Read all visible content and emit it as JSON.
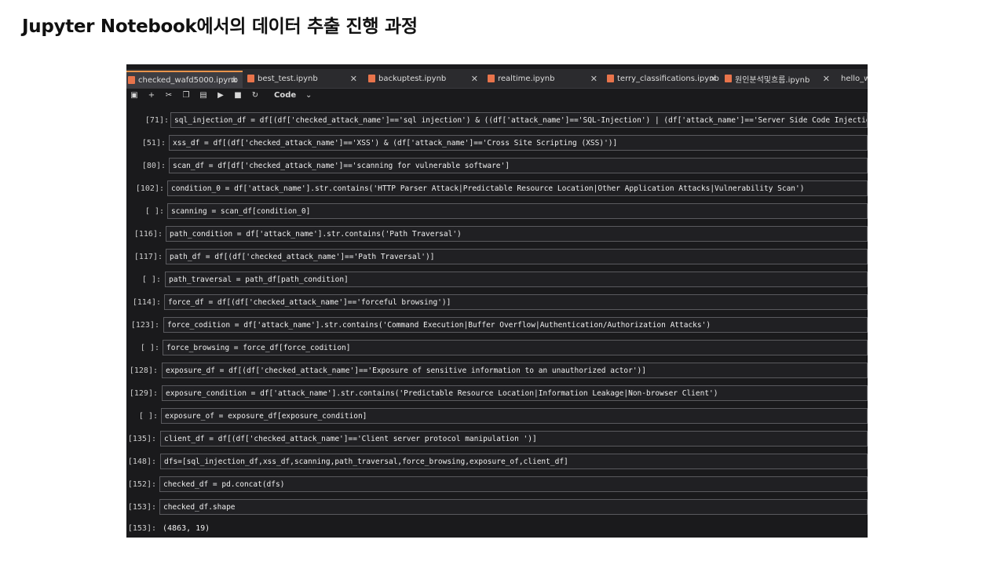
{
  "slide": {
    "title": "Jupyter Notebook에서의 데이터 추출 진행 과정"
  },
  "tabs": [
    {
      "label": "checked_wafd5000.ipynb",
      "close": "✕"
    },
    {
      "label": "best_test.ipynb",
      "close": "✕"
    },
    {
      "label": "backuptest.ipynb",
      "close": "✕"
    },
    {
      "label": "realtime.ipynb",
      "close": "✕"
    },
    {
      "label": "terry_classifications.ipynb",
      "close": "✕"
    },
    {
      "label": "원인분석및흐름.ipynb",
      "close": "✕"
    },
    {
      "label": "hello_w"
    }
  ],
  "toolbar": {
    "save_icon": "save-icon",
    "add_icon": "plus-icon",
    "cut_icon": "scissors-icon",
    "copy_icon": "copy-icon",
    "paste_icon": "paste-icon",
    "run_icon": "play-icon",
    "stop_icon": "stop-icon",
    "restart_icon": "restart-icon",
    "cell_type": "Code",
    "dropdown_icon": "chevron-down-icon"
  },
  "cells": [
    {
      "prompt": "[71]:",
      "code": "sql_injection_df = df[(df['checked_attack_name']=='sql injection') & ((df['attack_name']=='SQL-Injection') | (df['attack_name']=='Server Side Code Injection,SQL-Injection'))]"
    },
    {
      "prompt": "[51]:",
      "code": "xss_df = df[(df['checked_attack_name']=='XSS') & (df['attack_name']=='Cross Site Scripting (XSS)')]"
    },
    {
      "prompt": "[80]:",
      "code": "scan_df = df[df['checked_attack_name']=='scanning for vulnerable software']"
    },
    {
      "prompt": "[102]:",
      "code": "condition_0 = df['attack_name'].str.contains('HTTP Parser Attack|Predictable Resource Location|Other Application Attacks|Vulnerability Scan')"
    },
    {
      "prompt": "[ ]:",
      "code": "scanning = scan_df[condition_0]"
    },
    {
      "prompt": "[116]:",
      "code": "path_condition = df['attack_name'].str.contains('Path Traversal')"
    },
    {
      "prompt": "[117]:",
      "code": "path_df = df[(df['checked_attack_name']=='Path Traversal')]"
    },
    {
      "prompt": "[ ]:",
      "code": "path_traversal = path_df[path_condition]"
    },
    {
      "prompt": "[114]:",
      "code": "force_df = df[(df['checked_attack_name']=='forceful browsing')]"
    },
    {
      "prompt": "[123]:",
      "code": "force_codition = df['attack_name'].str.contains('Command Execution|Buffer Overflow|Authentication/Authorization Attacks')"
    },
    {
      "prompt": "[ ]:",
      "code": "force_browsing = force_df[force_codition]"
    },
    {
      "prompt": "[128]:",
      "code": "exposure_df = df[(df['checked_attack_name']=='Exposure of sensitive information to an unauthorized actor')]"
    },
    {
      "prompt": "[129]:",
      "code": "exposure_condition = df['attack_name'].str.contains('Predictable Resource Location|Information Leakage|Non-browser Client')"
    },
    {
      "prompt": "[ ]:",
      "code": "exposure_of = exposure_df[exposure_condition]"
    },
    {
      "prompt": "[135]:",
      "code": "client_df = df[(df['checked_attack_name']=='Client server protocol manipulation ')]"
    },
    {
      "prompt": "[148]:",
      "code": "dfs=[sql_injection_df,xss_df,scanning,path_traversal,force_browsing,exposure_of,client_df]"
    },
    {
      "prompt": "[152]:",
      "code": "checked_df = pd.concat(dfs)"
    },
    {
      "prompt": "[153]:",
      "code": "checked_df.shape"
    }
  ],
  "output": {
    "prompt": "[153]:",
    "value": "(4863, 19)"
  }
}
